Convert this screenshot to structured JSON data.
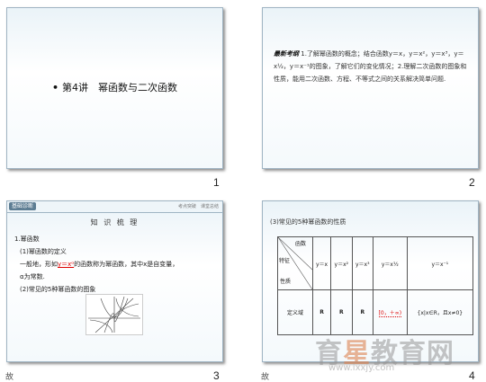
{
  "slides": [
    {
      "number": "1",
      "title": "第4讲　幂函数与二次函数",
      "bullet": "•"
    },
    {
      "number": "2",
      "label": "最新考纲",
      "body": "1.了解幂函数的概念；结合函数y＝x，y＝x²，y＝x³，y＝x½，y＝x⁻¹的图象，了解它们的变化情况；2.理解二次函数的图象和性质，能用二次函数、方程、不等式之间的关系解决简单问题."
    },
    {
      "number": "3",
      "tag": "基础诊断",
      "ref": "考点突破　课堂总结",
      "heading": "知 识 梳 理",
      "line1": "1.幂函数",
      "line2": "(1)幂函数的定义",
      "line3_pre": "一般地，形如",
      "line3_red": "y＝xᵅ",
      "line3_post": "的函数称为幂函数，其中x是自变量，",
      "line4": "α为常数.",
      "line5": "(2)常见的5种幂函数的图象",
      "trans": "故"
    },
    {
      "number": "4",
      "heading": "(3)常见的5种幂函数的性质",
      "corner_top": "函数",
      "corner_mid": "特征",
      "corner_bottom": "性质",
      "functions": [
        "y＝x",
        "y＝x²",
        "y＝x³",
        "y＝x½",
        "y＝x⁻¹"
      ],
      "row_label": "定义域",
      "domains": [
        "R",
        "R",
        "R",
        "[0，＋∞)",
        "{x|x∈R，且x≠0}"
      ],
      "trans": "故"
    }
  ],
  "watermark": {
    "text_pre": "育",
    "text_star": "星",
    "text_post": "教育网",
    "sub": "www.ixxjy.com"
  },
  "colors": {
    "accent_red": "#d00000",
    "slide_border": "#9fb4c3"
  }
}
